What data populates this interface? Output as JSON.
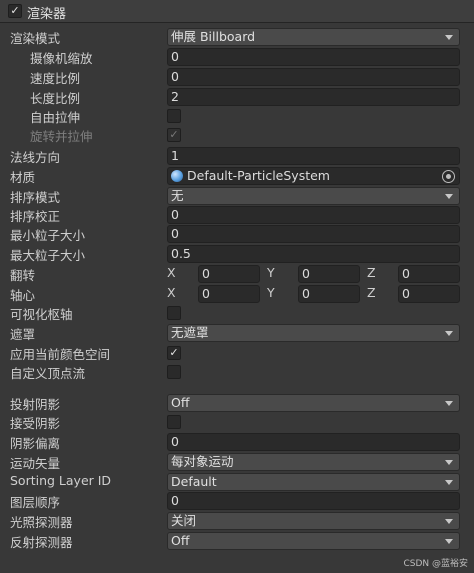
{
  "header": {
    "checked": "✓",
    "title": "渲染器"
  },
  "rows": {
    "render_mode": {
      "label": "渲染模式",
      "value": "伸展 Billboard"
    },
    "camera_scale": {
      "label": "摄像机缩放",
      "value": "0"
    },
    "speed_scale": {
      "label": "速度比例",
      "value": "0"
    },
    "length_scale": {
      "label": "长度比例",
      "value": "2"
    },
    "free_stretch": {
      "label": "自由拉伸",
      "checked": ""
    },
    "rotate_stretch": {
      "label": "旋转并拉伸",
      "checked": "✓"
    },
    "normal_direction": {
      "label": "法线方向",
      "value": "1"
    },
    "material": {
      "label": "材质",
      "value": "Default-ParticleSystem"
    },
    "sort_mode": {
      "label": "排序模式",
      "value": "无"
    },
    "sort_fudge": {
      "label": "排序校正",
      "value": "0"
    },
    "min_particle_size": {
      "label": "最小粒子大小",
      "value": "0"
    },
    "max_particle_size": {
      "label": "最大粒子大小",
      "value": "0.5"
    },
    "flip": {
      "label": "翻转",
      "x_label": "X",
      "y_label": "Y",
      "z_label": "Z",
      "x": "0",
      "y": "0",
      "z": "0"
    },
    "pivot": {
      "label": "轴心",
      "x_label": "X",
      "y_label": "Y",
      "z_label": "Z",
      "x": "0",
      "y": "0",
      "z": "0"
    },
    "visualize_pivot": {
      "label": "可视化枢轴",
      "checked": ""
    },
    "masking": {
      "label": "遮罩",
      "value": "无遮罩"
    },
    "apply_color_space": {
      "label": "应用当前颜色空间",
      "checked": "✓"
    },
    "custom_vertex_streams": {
      "label": "自定义顶点流",
      "checked": ""
    },
    "cast_shadows": {
      "label": "投射阴影",
      "value": "Off"
    },
    "receive_shadows": {
      "label": "接受阴影",
      "checked": ""
    },
    "shadow_bias": {
      "label": "阴影偏离",
      "value": "0"
    },
    "motion_vectors": {
      "label": "运动矢量",
      "value": "每对象运动"
    },
    "sorting_layer": {
      "label": "Sorting Layer ID",
      "value": "Default"
    },
    "order_in_layer": {
      "label": "图层顺序",
      "value": "0"
    },
    "light_probes": {
      "label": "光照探测器",
      "value": "关闭"
    },
    "reflection_probes": {
      "label": "反射探测器",
      "value": "Off"
    }
  },
  "watermark": "CSDN @蓝裕安"
}
